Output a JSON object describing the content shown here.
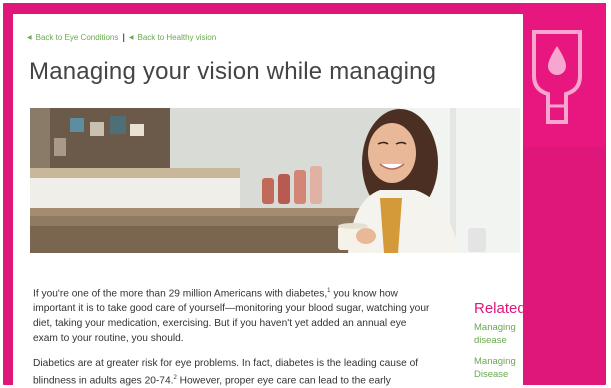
{
  "breadcrumb": {
    "back_eye_conditions": "Back to Eye Conditions",
    "separator": "|",
    "back_healthy_vision": "Back to Healthy vision"
  },
  "article": {
    "title": "Managing your vision while managing",
    "hero_image": "woman-smiling-holding-mug-in-kitchen",
    "paragraph1": {
      "text_a": "If you're one of the more than 29 million Americans with diabetes,",
      "sup_a": "1",
      "text_b": " you know how important it is to take good care of yourself—monitoring your blood sugar, watching your diet, taking your medication, exercising. But if you haven't yet added an annual eye exam to your routine, you should."
    },
    "paragraph2": {
      "text_a": "Diabetics are at greater risk for eye problems. In fact, diabetes is the leading cause of blindness in adults ages 20-74.",
      "sup_a": "2",
      "text_b": " However, proper eye care can lead to the early"
    }
  },
  "related": {
    "title": "Related",
    "links": [
      "Managing disease",
      "Managing Disease"
    ]
  },
  "badge": {
    "icon": "iv-drop-icon"
  },
  "colors": {
    "brand_pink": "#e0177a",
    "link_green": "#6aa84f",
    "text_dark": "#333333"
  }
}
